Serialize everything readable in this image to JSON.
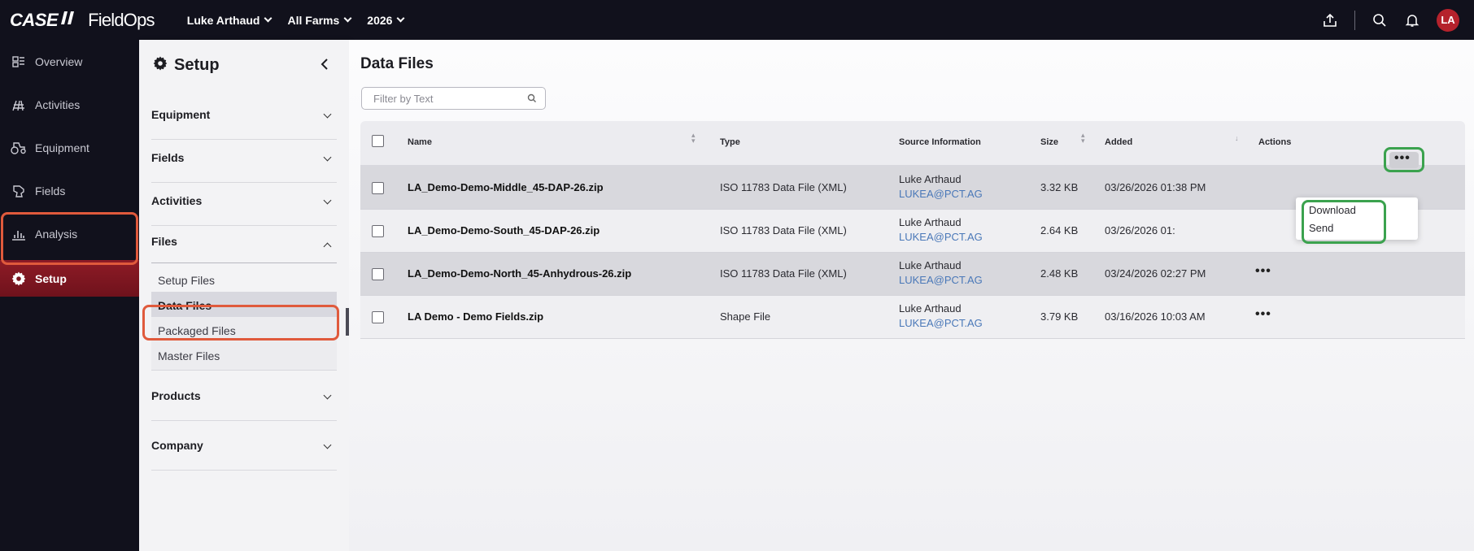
{
  "brand": {
    "logo_case": "CASE",
    "logo_ih": "IH",
    "logo_app": "FieldOps"
  },
  "topnav": {
    "user": "Luke Arthaud",
    "farms": "All Farms",
    "year": "2026"
  },
  "user": {
    "initials": "LA"
  },
  "sidebar": {
    "items": [
      {
        "label": "Overview",
        "icon": "overview-icon"
      },
      {
        "label": "Activities",
        "icon": "activities-icon"
      },
      {
        "label": "Equipment",
        "icon": "tractor-icon"
      },
      {
        "label": "Fields",
        "icon": "field-icon"
      },
      {
        "label": "Analysis",
        "icon": "chart-icon"
      },
      {
        "label": "Setup",
        "icon": "gear-icon",
        "active": true
      }
    ]
  },
  "setup_panel": {
    "title": "Setup",
    "sections": [
      "Equipment",
      "Fields",
      "Activities",
      "Files",
      "Products",
      "Company"
    ],
    "files_sub": [
      "Setup Files",
      "Data Files",
      "Packaged Files",
      "Master Files"
    ],
    "active_sub": "Data Files"
  },
  "main": {
    "title": "Data Files",
    "filter_placeholder": "Filter by Text",
    "columns": [
      "Name",
      "Type",
      "Source Information",
      "Size",
      "Added",
      "Actions"
    ],
    "rows": [
      {
        "name": "LA_Demo-Demo-Middle_45-DAP-26.zip",
        "type": "ISO 11783 Data File (XML)",
        "source_name": "Luke Arthaud",
        "source_email": "LUKEA@PCT.AG",
        "size": "3.32 KB",
        "added": "03/26/2026 01:38 PM"
      },
      {
        "name": "LA_Demo-Demo-South_45-DAP-26.zip",
        "type": "ISO 11783 Data File (XML)",
        "source_name": "Luke Arthaud",
        "source_email": "LUKEA@PCT.AG",
        "size": "2.64 KB",
        "added": "03/26/2026 01:"
      },
      {
        "name": "LA_Demo-Demo-North_45-Anhydrous-26.zip",
        "type": "ISO 11783 Data File (XML)",
        "source_name": "Luke Arthaud",
        "source_email": "LUKEA@PCT.AG",
        "size": "2.48 KB",
        "added": "03/24/2026 02:27 PM"
      },
      {
        "name": "LA Demo - Demo Fields.zip",
        "type": "Shape File",
        "source_name": "Luke Arthaud",
        "source_email": "LUKEA@PCT.AG",
        "size": "3.79 KB",
        "added": "03/16/2026 10:03 AM"
      }
    ],
    "actions_menu": [
      "Download",
      "Send"
    ],
    "actions_glyph": "•••"
  },
  "colors": {
    "nav_bg": "#11111c",
    "active_red": "#8e1b26",
    "highlight_red": "#e05a3c",
    "highlight_green": "#3ba24e",
    "link_blue": "#4a78b8"
  }
}
